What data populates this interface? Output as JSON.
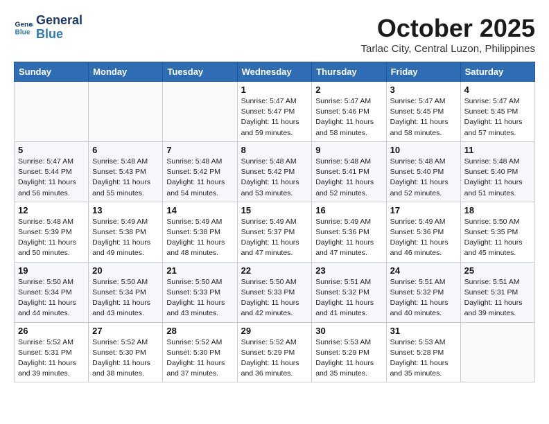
{
  "header": {
    "logo_line1": "General",
    "logo_line2": "Blue",
    "month_title": "October 2025",
    "subtitle": "Tarlac City, Central Luzon, Philippines"
  },
  "weekdays": [
    "Sunday",
    "Monday",
    "Tuesday",
    "Wednesday",
    "Thursday",
    "Friday",
    "Saturday"
  ],
  "weeks": [
    [
      {
        "day": "",
        "sunrise": "",
        "sunset": "",
        "daylight": ""
      },
      {
        "day": "",
        "sunrise": "",
        "sunset": "",
        "daylight": ""
      },
      {
        "day": "",
        "sunrise": "",
        "sunset": "",
        "daylight": ""
      },
      {
        "day": "1",
        "sunrise": "Sunrise: 5:47 AM",
        "sunset": "Sunset: 5:47 PM",
        "daylight": "Daylight: 11 hours and 59 minutes."
      },
      {
        "day": "2",
        "sunrise": "Sunrise: 5:47 AM",
        "sunset": "Sunset: 5:46 PM",
        "daylight": "Daylight: 11 hours and 58 minutes."
      },
      {
        "day": "3",
        "sunrise": "Sunrise: 5:47 AM",
        "sunset": "Sunset: 5:45 PM",
        "daylight": "Daylight: 11 hours and 58 minutes."
      },
      {
        "day": "4",
        "sunrise": "Sunrise: 5:47 AM",
        "sunset": "Sunset: 5:45 PM",
        "daylight": "Daylight: 11 hours and 57 minutes."
      }
    ],
    [
      {
        "day": "5",
        "sunrise": "Sunrise: 5:47 AM",
        "sunset": "Sunset: 5:44 PM",
        "daylight": "Daylight: 11 hours and 56 minutes."
      },
      {
        "day": "6",
        "sunrise": "Sunrise: 5:48 AM",
        "sunset": "Sunset: 5:43 PM",
        "daylight": "Daylight: 11 hours and 55 minutes."
      },
      {
        "day": "7",
        "sunrise": "Sunrise: 5:48 AM",
        "sunset": "Sunset: 5:42 PM",
        "daylight": "Daylight: 11 hours and 54 minutes."
      },
      {
        "day": "8",
        "sunrise": "Sunrise: 5:48 AM",
        "sunset": "Sunset: 5:42 PM",
        "daylight": "Daylight: 11 hours and 53 minutes."
      },
      {
        "day": "9",
        "sunrise": "Sunrise: 5:48 AM",
        "sunset": "Sunset: 5:41 PM",
        "daylight": "Daylight: 11 hours and 52 minutes."
      },
      {
        "day": "10",
        "sunrise": "Sunrise: 5:48 AM",
        "sunset": "Sunset: 5:40 PM",
        "daylight": "Daylight: 11 hours and 52 minutes."
      },
      {
        "day": "11",
        "sunrise": "Sunrise: 5:48 AM",
        "sunset": "Sunset: 5:40 PM",
        "daylight": "Daylight: 11 hours and 51 minutes."
      }
    ],
    [
      {
        "day": "12",
        "sunrise": "Sunrise: 5:48 AM",
        "sunset": "Sunset: 5:39 PM",
        "daylight": "Daylight: 11 hours and 50 minutes."
      },
      {
        "day": "13",
        "sunrise": "Sunrise: 5:49 AM",
        "sunset": "Sunset: 5:38 PM",
        "daylight": "Daylight: 11 hours and 49 minutes."
      },
      {
        "day": "14",
        "sunrise": "Sunrise: 5:49 AM",
        "sunset": "Sunset: 5:38 PM",
        "daylight": "Daylight: 11 hours and 48 minutes."
      },
      {
        "day": "15",
        "sunrise": "Sunrise: 5:49 AM",
        "sunset": "Sunset: 5:37 PM",
        "daylight": "Daylight: 11 hours and 47 minutes."
      },
      {
        "day": "16",
        "sunrise": "Sunrise: 5:49 AM",
        "sunset": "Sunset: 5:36 PM",
        "daylight": "Daylight: 11 hours and 47 minutes."
      },
      {
        "day": "17",
        "sunrise": "Sunrise: 5:49 AM",
        "sunset": "Sunset: 5:36 PM",
        "daylight": "Daylight: 11 hours and 46 minutes."
      },
      {
        "day": "18",
        "sunrise": "Sunrise: 5:50 AM",
        "sunset": "Sunset: 5:35 PM",
        "daylight": "Daylight: 11 hours and 45 minutes."
      }
    ],
    [
      {
        "day": "19",
        "sunrise": "Sunrise: 5:50 AM",
        "sunset": "Sunset: 5:34 PM",
        "daylight": "Daylight: 11 hours and 44 minutes."
      },
      {
        "day": "20",
        "sunrise": "Sunrise: 5:50 AM",
        "sunset": "Sunset: 5:34 PM",
        "daylight": "Daylight: 11 hours and 43 minutes."
      },
      {
        "day": "21",
        "sunrise": "Sunrise: 5:50 AM",
        "sunset": "Sunset: 5:33 PM",
        "daylight": "Daylight: 11 hours and 43 minutes."
      },
      {
        "day": "22",
        "sunrise": "Sunrise: 5:50 AM",
        "sunset": "Sunset: 5:33 PM",
        "daylight": "Daylight: 11 hours and 42 minutes."
      },
      {
        "day": "23",
        "sunrise": "Sunrise: 5:51 AM",
        "sunset": "Sunset: 5:32 PM",
        "daylight": "Daylight: 11 hours and 41 minutes."
      },
      {
        "day": "24",
        "sunrise": "Sunrise: 5:51 AM",
        "sunset": "Sunset: 5:32 PM",
        "daylight": "Daylight: 11 hours and 40 minutes."
      },
      {
        "day": "25",
        "sunrise": "Sunrise: 5:51 AM",
        "sunset": "Sunset: 5:31 PM",
        "daylight": "Daylight: 11 hours and 39 minutes."
      }
    ],
    [
      {
        "day": "26",
        "sunrise": "Sunrise: 5:52 AM",
        "sunset": "Sunset: 5:31 PM",
        "daylight": "Daylight: 11 hours and 39 minutes."
      },
      {
        "day": "27",
        "sunrise": "Sunrise: 5:52 AM",
        "sunset": "Sunset: 5:30 PM",
        "daylight": "Daylight: 11 hours and 38 minutes."
      },
      {
        "day": "28",
        "sunrise": "Sunrise: 5:52 AM",
        "sunset": "Sunset: 5:30 PM",
        "daylight": "Daylight: 11 hours and 37 minutes."
      },
      {
        "day": "29",
        "sunrise": "Sunrise: 5:52 AM",
        "sunset": "Sunset: 5:29 PM",
        "daylight": "Daylight: 11 hours and 36 minutes."
      },
      {
        "day": "30",
        "sunrise": "Sunrise: 5:53 AM",
        "sunset": "Sunset: 5:29 PM",
        "daylight": "Daylight: 11 hours and 35 minutes."
      },
      {
        "day": "31",
        "sunrise": "Sunrise: 5:53 AM",
        "sunset": "Sunset: 5:28 PM",
        "daylight": "Daylight: 11 hours and 35 minutes."
      },
      {
        "day": "",
        "sunrise": "",
        "sunset": "",
        "daylight": ""
      }
    ]
  ]
}
